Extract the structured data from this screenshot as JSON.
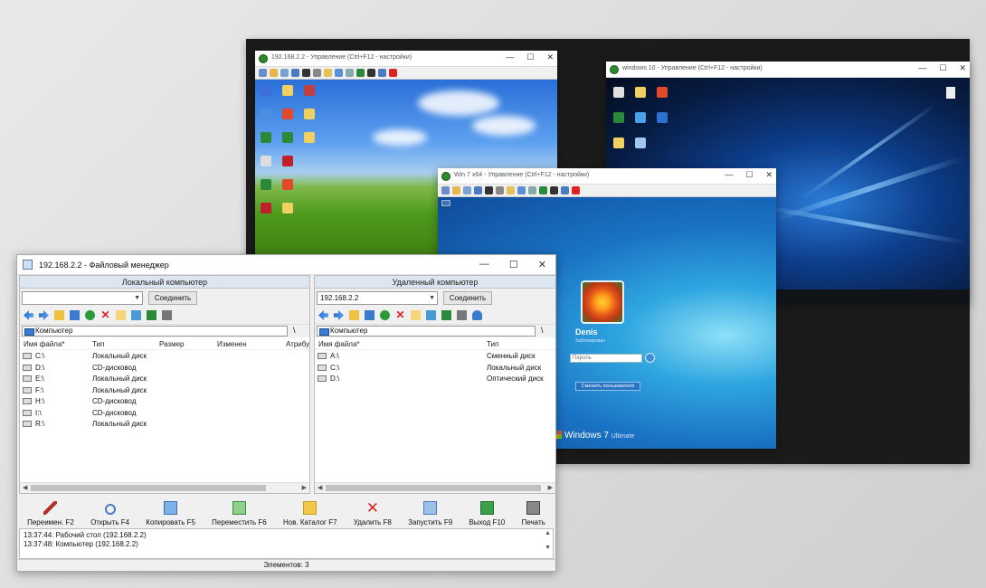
{
  "xp_window": {
    "title": "192.168.2.2 - Управление    (Ctrl+F12 - настройки)",
    "controls": [
      "—",
      "☐",
      "✕"
    ]
  },
  "win10_window": {
    "title": "windows 10 - Управление    (Ctrl+F12 - настройки)",
    "controls": [
      "—",
      "☐",
      "✕"
    ]
  },
  "win7_window": {
    "title": "Win 7 x64 - Управление    (Ctrl+F12 - настройки)",
    "controls": [
      "—",
      "☐",
      "✕"
    ],
    "user_name": "Denis",
    "user_subtitle": "Заблокирован",
    "password_placeholder": "Пароль",
    "switch_user": "Сменить пользователя",
    "brand": "Windows",
    "brand_ver": "7",
    "brand_edition": "Ultimate"
  },
  "fm": {
    "title": "192.168.2.2 - Файловый менеджер",
    "controls": [
      "—",
      "☐",
      "✕"
    ],
    "local": {
      "header": "Локальный компьютер",
      "combo": "",
      "connect": "Соединить",
      "path": "Компьютер",
      "columns": [
        "Имя файла*",
        "Тип",
        "Размер",
        "Изменен",
        "Атрибу"
      ],
      "files": [
        {
          "name": "C:\\",
          "type": "Локальный диск"
        },
        {
          "name": "D:\\",
          "type": "CD-дисковод"
        },
        {
          "name": "E:\\",
          "type": "Локальный диск"
        },
        {
          "name": "F:\\",
          "type": "Локальный диск"
        },
        {
          "name": "H:\\",
          "type": "CD-дисковод"
        },
        {
          "name": "I:\\",
          "type": "CD-дисковод"
        },
        {
          "name": "R:\\",
          "type": "Локальный диск"
        }
      ]
    },
    "remote": {
      "header": "Удаленный компьютер",
      "combo": "192.168.2.2",
      "connect": "Соединить",
      "path": "Компьютер",
      "columns": [
        "Имя файла*",
        "Тип"
      ],
      "files": [
        {
          "name": "A:\\",
          "type": "Сменный диск"
        },
        {
          "name": "C:\\",
          "type": "Локальный диск"
        },
        {
          "name": "D:\\",
          "type": "Оптический диск"
        }
      ]
    },
    "fkeys": [
      "Переимен. F2",
      "Открыть F4",
      "Копировать F5",
      "Переместить F6",
      "Нов. Каталог F7",
      "Удалить F8",
      "Запустить F9",
      "Выход F10",
      "Печать"
    ],
    "log": [
      "13:37:44: Рабочий стол   (192.168.2.2)",
      "13:37:48: Компьютер   (192.168.2.2)"
    ],
    "status": "Элементов: 3"
  }
}
